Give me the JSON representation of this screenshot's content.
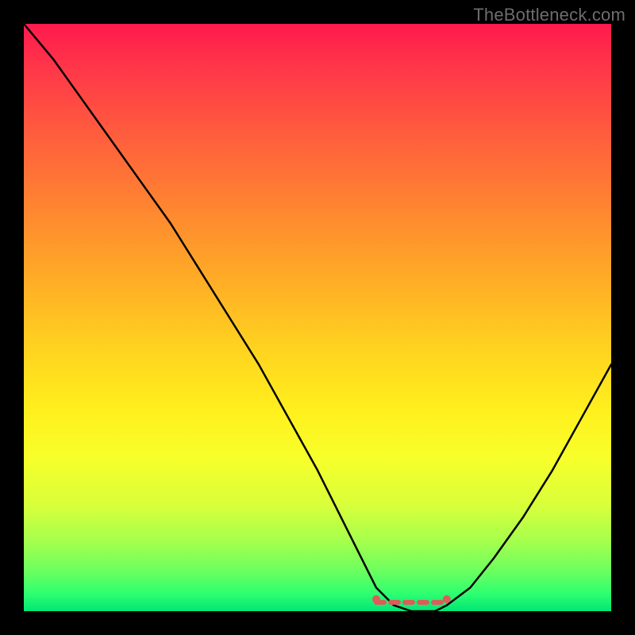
{
  "watermark_text": "TheBottleneck.com",
  "colors": {
    "frame": "#000000",
    "curve": "#000000",
    "optimal_marker": "#e05a5a",
    "gradient_top": "#ff1a4d",
    "gradient_mid": "#fff01e",
    "gradient_bottom": "#00e676"
  },
  "chart_data": {
    "type": "line",
    "title": "",
    "xlabel": "",
    "ylabel": "",
    "xlim": [
      0,
      100
    ],
    "ylim": [
      0,
      100
    ],
    "grid": false,
    "legend": false,
    "description": "Bottleneck severity curve; y≈0 means optimal match. Background color gradient encodes vertical axis (red high → green low).",
    "series": [
      {
        "name": "bottleneck-curve",
        "x": [
          0,
          5,
          10,
          15,
          20,
          25,
          30,
          35,
          40,
          45,
          50,
          55,
          58,
          60,
          63,
          66,
          70,
          72,
          76,
          80,
          85,
          90,
          95,
          100
        ],
        "y": [
          100,
          94,
          87,
          80,
          73,
          66,
          58,
          50,
          42,
          33,
          24,
          14,
          8,
          4,
          1,
          0,
          0,
          1,
          4,
          9,
          16,
          24,
          33,
          42
        ]
      }
    ],
    "optimal_range_x": [
      60,
      72
    ],
    "annotations": []
  }
}
